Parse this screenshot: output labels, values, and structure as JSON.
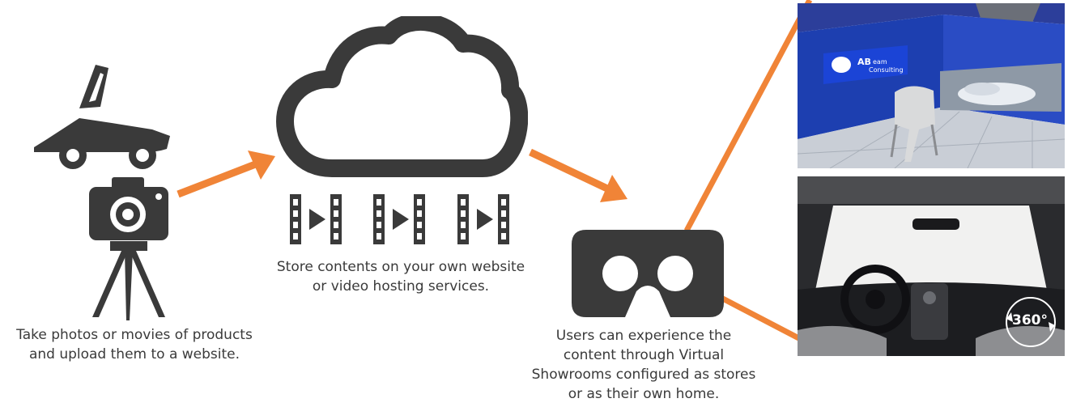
{
  "steps": {
    "capture": {
      "caption": "Take photos or movies of products\nand upload them to a website.",
      "icons": [
        "sports-car-icon",
        "camera-icon",
        "tripod-icon"
      ]
    },
    "store": {
      "caption": "Store contents on your own website\nor video hosting services.",
      "icons": [
        "cloud-icon",
        "film-strip-icon",
        "film-strip-icon",
        "film-strip-icon"
      ]
    },
    "experience": {
      "caption": "Users can experience the\ncontent through Virtual\nShowrooms configured as stores\nor as their own home.",
      "icons": [
        "vr-headset-icon"
      ]
    }
  },
  "photos": {
    "showroom": {
      "logo_text": "AB",
      "logo_sub_1": "eam",
      "logo_sub_2": "Consulting"
    },
    "interior": {
      "badge": "360°"
    }
  },
  "colors": {
    "arrow": "#f08437",
    "icon": "#3a3a3a",
    "showroom_blue": "#1d3fb0"
  }
}
